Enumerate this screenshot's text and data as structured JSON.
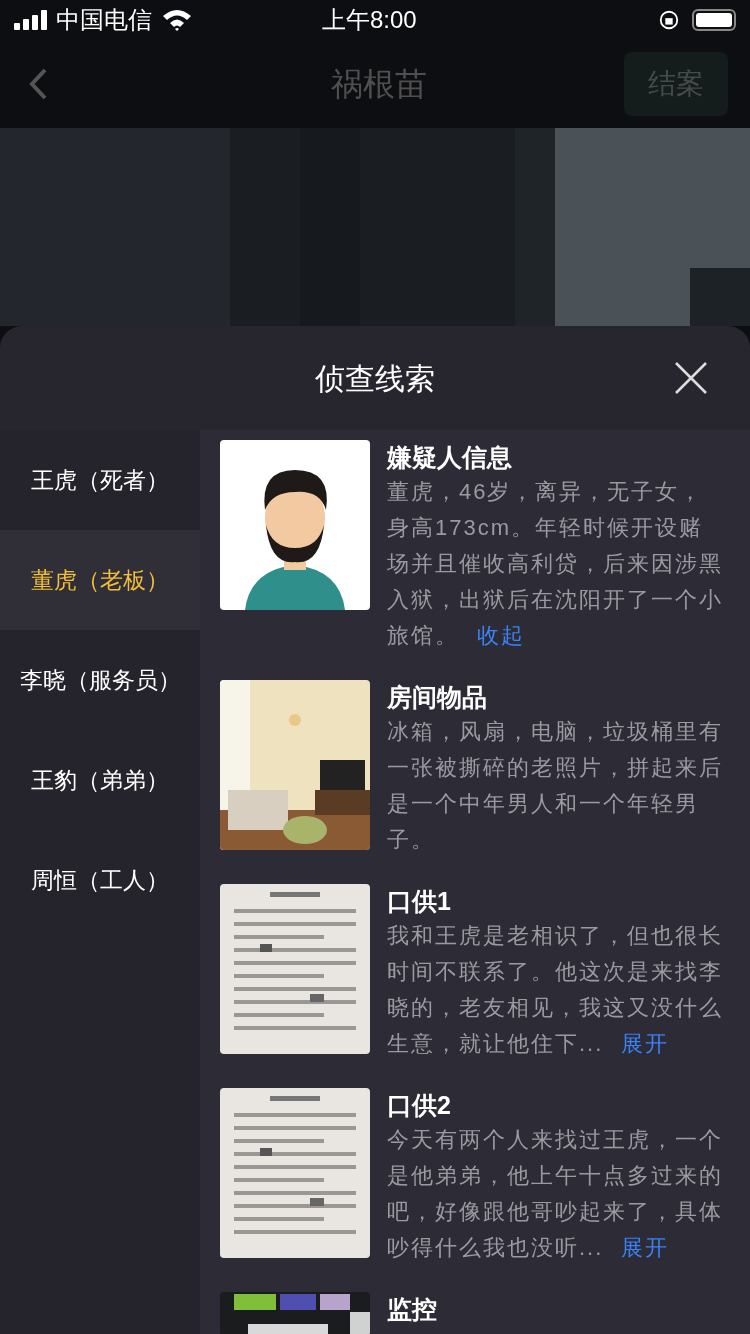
{
  "status_bar": {
    "carrier": "中国电信",
    "time": "上午8:00"
  },
  "nav": {
    "title": "祸根苗",
    "action": "结案"
  },
  "sheet": {
    "title": "侦查线索",
    "suspects": [
      {
        "label": "王虎（死者）",
        "selected": false
      },
      {
        "label": "董虎（老板）",
        "selected": true
      },
      {
        "label": "李晓（服务员）",
        "selected": false
      },
      {
        "label": "王豹（弟弟）",
        "selected": false
      },
      {
        "label": "周恒（工人）",
        "selected": false
      }
    ],
    "clues": [
      {
        "kind": "avatar",
        "title": "嫌疑人信息",
        "text": "董虎，46岁，离异，无子女，身高173cm。年轻时候开设赌场并且催收高利贷，后来因涉黑入狱，出狱后在沈阳开了一个小旅馆。",
        "toggle": "收起"
      },
      {
        "kind": "room",
        "title": "房间物品",
        "text": "冰箱，风扇，电脑，垃圾桶里有一张被撕碎的老照片，拼起来后是一个中年男人和一个年轻男子。"
      },
      {
        "kind": "document",
        "title": "口供1",
        "text": "我和王虎是老相识了，但也很长时间不联系了。他这次是来找李晓的，老友相见，我这又没什么生意，就让他住下...",
        "toggle": "展开"
      },
      {
        "kind": "document",
        "title": "口供2",
        "text": "今天有两个人来找过王虎，一个是他弟弟，他上午十点多过来的吧，好像跟他哥吵起来了，具体吵得什么我也没听...",
        "toggle": "展开"
      },
      {
        "kind": "monitor",
        "title": "监控"
      }
    ]
  }
}
